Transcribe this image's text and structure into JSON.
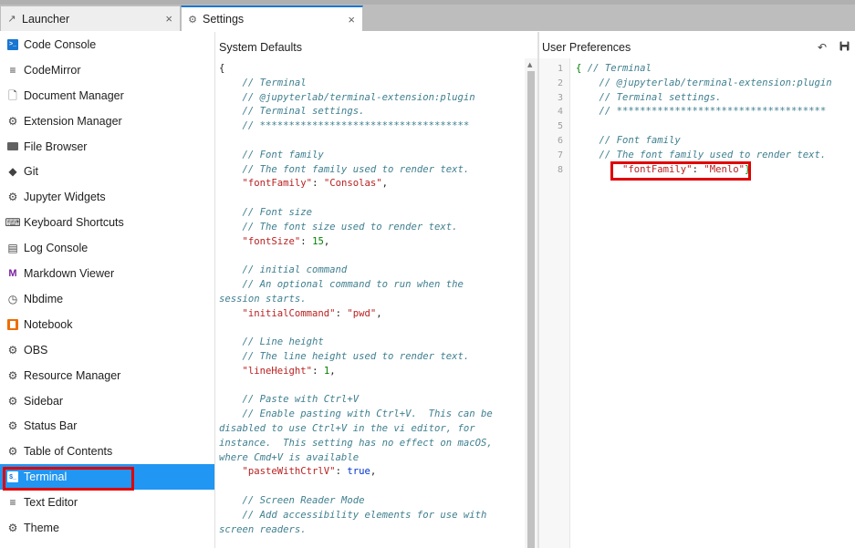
{
  "tabs": [
    {
      "label": "Launcher",
      "icon": "launcher-icon",
      "close": "×",
      "active": false
    },
    {
      "label": "Settings",
      "icon": "gear-icon",
      "close": "×",
      "active": true
    }
  ],
  "sidebar": {
    "items": [
      {
        "label": "Code Console",
        "icon": "console-icon"
      },
      {
        "label": "CodeMirror",
        "icon": "text-lines-icon"
      },
      {
        "label": "Document Manager",
        "icon": "document-icon"
      },
      {
        "label": "Extension Manager",
        "icon": "gear-icon"
      },
      {
        "label": "File Browser",
        "icon": "folder-icon"
      },
      {
        "label": "Git",
        "icon": "git-icon"
      },
      {
        "label": "Jupyter Widgets",
        "icon": "gear-icon"
      },
      {
        "label": "Keyboard Shortcuts",
        "icon": "keyboard-icon"
      },
      {
        "label": "Log Console",
        "icon": "list-icon"
      },
      {
        "label": "Markdown Viewer",
        "icon": "markdown-icon"
      },
      {
        "label": "Nbdime",
        "icon": "clock-icon"
      },
      {
        "label": "Notebook",
        "icon": "notebook-icon"
      },
      {
        "label": "OBS",
        "icon": "gear-icon"
      },
      {
        "label": "Resource Manager",
        "icon": "gears-icon"
      },
      {
        "label": "Sidebar",
        "icon": "gear-icon"
      },
      {
        "label": "Status Bar",
        "icon": "gear-icon"
      },
      {
        "label": "Table of Contents",
        "icon": "gear-icon"
      },
      {
        "label": "Terminal",
        "icon": "terminal-icon",
        "selected": true
      },
      {
        "label": "Text Editor",
        "icon": "text-lines-icon"
      },
      {
        "label": "Theme",
        "icon": "gear-icon"
      }
    ]
  },
  "system_defaults": {
    "header": "System Defaults",
    "lines": [
      [
        {
          "t": "{",
          "c": "punct"
        }
      ],
      [
        {
          "t": "    // Terminal",
          "c": "comment"
        }
      ],
      [
        {
          "t": "    // @jupyterlab/terminal-extension:plugin",
          "c": "comment"
        }
      ],
      [
        {
          "t": "    // Terminal settings.",
          "c": "comment"
        }
      ],
      [
        {
          "t": "    // ************************************",
          "c": "comment"
        }
      ],
      [
        {
          "t": "",
          "c": "punct"
        }
      ],
      [
        {
          "t": "    // Font family",
          "c": "comment"
        }
      ],
      [
        {
          "t": "    // The font family used to render text.",
          "c": "comment"
        }
      ],
      [
        {
          "t": "    \"fontFamily\"",
          "c": "key"
        },
        {
          "t": ": ",
          "c": "punct"
        },
        {
          "t": "\"Consolas\"",
          "c": "str"
        },
        {
          "t": ",",
          "c": "punct"
        }
      ],
      [
        {
          "t": "",
          "c": "punct"
        }
      ],
      [
        {
          "t": "    // Font size",
          "c": "comment"
        }
      ],
      [
        {
          "t": "    // The font size used to render text.",
          "c": "comment"
        }
      ],
      [
        {
          "t": "    \"fontSize\"",
          "c": "key"
        },
        {
          "t": ": ",
          "c": "punct"
        },
        {
          "t": "15",
          "c": "num"
        },
        {
          "t": ",",
          "c": "punct"
        }
      ],
      [
        {
          "t": "",
          "c": "punct"
        }
      ],
      [
        {
          "t": "    // initial command",
          "c": "comment"
        }
      ],
      [
        {
          "t": "    // An optional command to run when the",
          "c": "comment"
        }
      ],
      [
        {
          "t": "session starts.",
          "c": "comment"
        }
      ],
      [
        {
          "t": "    \"initialCommand\"",
          "c": "key"
        },
        {
          "t": ": ",
          "c": "punct"
        },
        {
          "t": "\"pwd\"",
          "c": "str"
        },
        {
          "t": ",",
          "c": "punct"
        }
      ],
      [
        {
          "t": "",
          "c": "punct"
        }
      ],
      [
        {
          "t": "    // Line height",
          "c": "comment"
        }
      ],
      [
        {
          "t": "    // The line height used to render text.",
          "c": "comment"
        }
      ],
      [
        {
          "t": "    \"lineHeight\"",
          "c": "key"
        },
        {
          "t": ": ",
          "c": "punct"
        },
        {
          "t": "1",
          "c": "num"
        },
        {
          "t": ",",
          "c": "punct"
        }
      ],
      [
        {
          "t": "",
          "c": "punct"
        }
      ],
      [
        {
          "t": "    // Paste with Ctrl+V",
          "c": "comment"
        }
      ],
      [
        {
          "t": "    // Enable pasting with Ctrl+V.  This can be",
          "c": "comment"
        }
      ],
      [
        {
          "t": "disabled to use Ctrl+V in the vi editor, for",
          "c": "comment"
        }
      ],
      [
        {
          "t": "instance.  This setting has no effect on macOS,",
          "c": "comment"
        }
      ],
      [
        {
          "t": "where Cmd+V is available",
          "c": "comment"
        }
      ],
      [
        {
          "t": "    \"pasteWithCtrlV\"",
          "c": "key"
        },
        {
          "t": ": ",
          "c": "punct"
        },
        {
          "t": "true",
          "c": "bool"
        },
        {
          "t": ",",
          "c": "punct"
        }
      ],
      [
        {
          "t": "",
          "c": "punct"
        }
      ],
      [
        {
          "t": "    // Screen Reader Mode",
          "c": "comment"
        }
      ],
      [
        {
          "t": "    // Add accessibility elements for use with",
          "c": "comment"
        }
      ],
      [
        {
          "t": "screen readers.",
          "c": "comment"
        }
      ]
    ]
  },
  "user_preferences": {
    "header": "User Preferences",
    "undo_icon": "undo-icon",
    "save_icon": "save-icon",
    "line_numbers": [
      "1",
      "2",
      "3",
      "4",
      "5",
      "6",
      "7",
      "8"
    ],
    "lines": [
      [
        {
          "t": "{ ",
          "c": "brace"
        },
        {
          "t": "// Terminal",
          "c": "comment"
        }
      ],
      [
        {
          "t": "    // @jupyterlab/terminal-extension:plugin",
          "c": "comment"
        }
      ],
      [
        {
          "t": "    // Terminal settings.",
          "c": "comment"
        }
      ],
      [
        {
          "t": "    // ************************************",
          "c": "comment"
        }
      ],
      [
        {
          "t": "",
          "c": "punct"
        }
      ],
      [
        {
          "t": "    // Font family",
          "c": "comment"
        }
      ],
      [
        {
          "t": "    // The font family used to render text.",
          "c": "comment"
        }
      ],
      [
        {
          "t": "        \"fontFamily\"",
          "c": "key"
        },
        {
          "t": ": ",
          "c": "punct"
        },
        {
          "t": "\"Menlo\"",
          "c": "str"
        },
        {
          "t": "}",
          "c": "brace"
        }
      ]
    ]
  },
  "colors": {
    "accent": "#2196f3",
    "highlight": "#e00000",
    "tab_active_border": "#1976d2"
  }
}
